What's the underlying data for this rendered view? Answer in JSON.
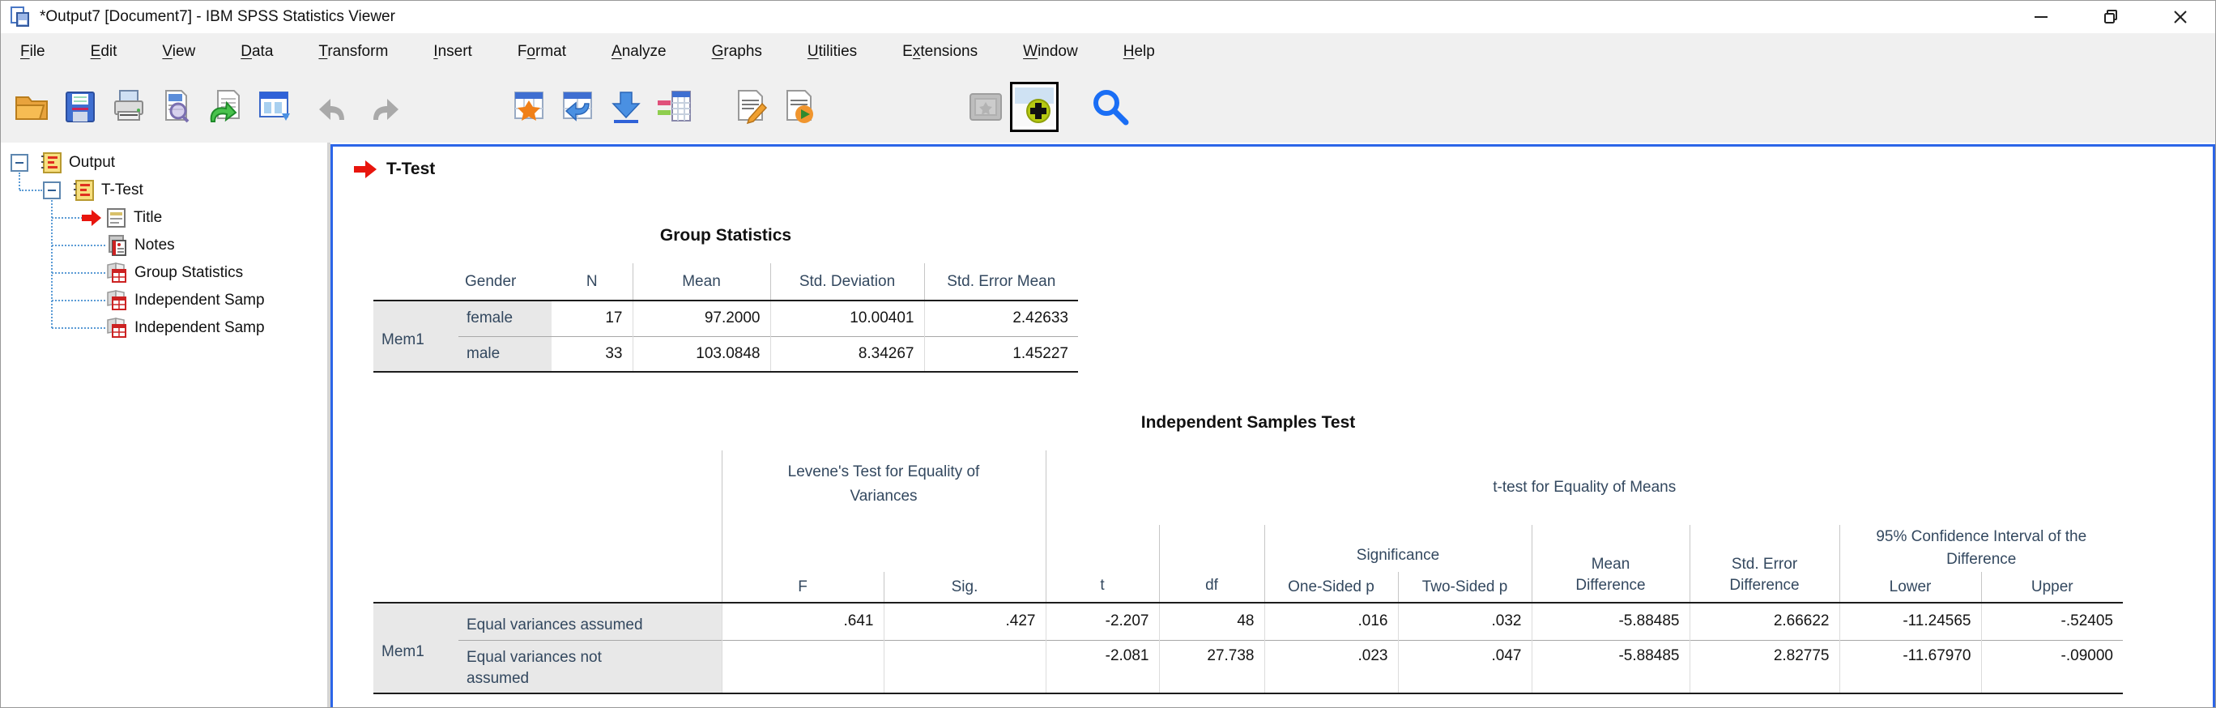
{
  "window": {
    "title": "*Output7 [Document7] - IBM SPSS Statistics Viewer",
    "controls": [
      "minimize",
      "restore",
      "close"
    ]
  },
  "menu": {
    "items": [
      {
        "label": "File",
        "key": "F"
      },
      {
        "label": "Edit",
        "key": "E"
      },
      {
        "label": "View",
        "key": "V"
      },
      {
        "label": "Data",
        "key": "D"
      },
      {
        "label": "Transform",
        "key": "T"
      },
      {
        "label": "Insert",
        "key": "I"
      },
      {
        "label": "Format",
        "key": "o"
      },
      {
        "label": "Analyze",
        "key": "A"
      },
      {
        "label": "Graphs",
        "key": "G"
      },
      {
        "label": "Utilities",
        "key": "U"
      },
      {
        "label": "Extensions",
        "key": "x"
      },
      {
        "label": "Window",
        "key": "W"
      },
      {
        "label": "Help",
        "key": "H"
      }
    ]
  },
  "toolbar": {
    "icons": [
      "open-folder-icon",
      "save-icon",
      "print-icon",
      "print-preview-icon",
      "recall-dialogs-icon",
      "goto-data-window-icon",
      "undo-icon",
      "redo-icon",
      "insert-pivot-table-icon",
      "goto-case-icon",
      "goto-data-icon",
      "variables-icon",
      "edit-output-icon",
      "export-output-icon",
      "designated-window-icon",
      "show-hide-icon",
      "find-icon"
    ]
  },
  "tree": {
    "items": [
      {
        "label": "Output"
      },
      {
        "label": "T-Test"
      },
      {
        "label": "Title"
      },
      {
        "label": "Notes"
      },
      {
        "label": "Group Statistics"
      },
      {
        "label": "Independent Samp"
      },
      {
        "label": "Independent Samp"
      }
    ]
  },
  "content": {
    "heading": "T-Test",
    "group_statistics": {
      "title": "Group Statistics",
      "columns": {
        "gender": "Gender",
        "n": "N",
        "mean": "Mean",
        "std_deviation": "Std. Deviation",
        "std_error_mean": "Std. Error Mean"
      },
      "rows": [
        {
          "row_label": "Mem1",
          "gender": "female",
          "n": "17",
          "mean": "97.2000",
          "std_deviation": "10.00401",
          "std_error_mean": "2.42633"
        },
        {
          "row_label": "",
          "gender": "male",
          "n": "33",
          "mean": "103.0848",
          "std_deviation": "8.34267",
          "std_error_mean": "1.45227"
        }
      ]
    },
    "independent_samples_test": {
      "title": "Independent Samples Test",
      "header": {
        "levene": "Levene's Test for Equality of Variances",
        "ttest": "t-test for Equality of Means",
        "significance": "Significance",
        "ci": "95% Confidence Interval of the Difference",
        "f": "F",
        "sig": "Sig.",
        "t": "t",
        "df": "df",
        "one_sided": "One-Sided p",
        "two_sided": "Two-Sided p",
        "mean_diff": "Mean Difference",
        "std_err_diff": "Std. Error Difference",
        "lower": "Lower",
        "upper": "Upper"
      },
      "rows": [
        {
          "row_label": "Mem1",
          "condition": "Equal variances assumed",
          "f": ".641",
          "sig": ".427",
          "t": "-2.207",
          "df": "48",
          "one_sided_p": ".016",
          "two_sided_p": ".032",
          "mean_difference": "-5.88485",
          "std_error_difference": "2.66622",
          "lower": "-11.24565",
          "upper": "-.52405"
        },
        {
          "row_label": "",
          "condition": "Equal variances not assumed",
          "f": "",
          "sig": "",
          "t": "-2.081",
          "df": "27.738",
          "one_sided_p": ".023",
          "two_sided_p": ".047",
          "mean_difference": "-5.88485",
          "std_error_difference": "2.82775",
          "lower": "-11.67970",
          "upper": "-.09000"
        }
      ]
    }
  },
  "colors": {
    "accent_border": "#2b65e8",
    "header_text": "#33485f",
    "row_label_bg": "#e8e8e8",
    "toolbar_bg": "#f0f0f0",
    "red_arrow": "#e8150d",
    "tree_connector": "#5b9bd5"
  }
}
